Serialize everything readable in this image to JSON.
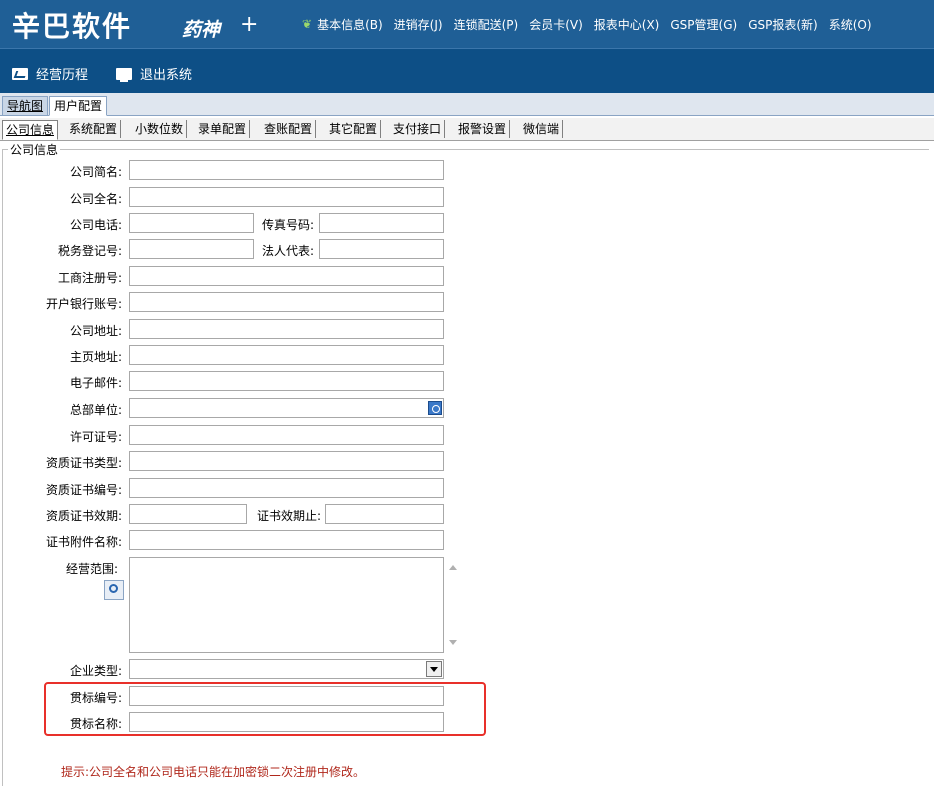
{
  "app": {
    "logo": "辛巴软件",
    "logo_sub": "药神",
    "logo_plus": "+"
  },
  "menu": [
    {
      "label": "基本信息(B)"
    },
    {
      "label": "进销存(J)"
    },
    {
      "label": "连锁配送(P)"
    },
    {
      "label": "会员卡(V)"
    },
    {
      "label": "报表中心(X)"
    },
    {
      "label": "GSP管理(G)"
    },
    {
      "label": "GSP报表(新)"
    },
    {
      "label": "系统(O)"
    }
  ],
  "toolbar": {
    "history_label": "经营历程",
    "exit_label": "退出系统"
  },
  "top_tabs": [
    {
      "label": "导航图"
    },
    {
      "label": "用户配置"
    }
  ],
  "config_tabs": [
    {
      "label": "公司信息"
    },
    {
      "label": "系统配置"
    },
    {
      "label": "小数位数"
    },
    {
      "label": "录单配置"
    },
    {
      "label": "查账配置"
    },
    {
      "label": "其它配置"
    },
    {
      "label": "支付接口"
    },
    {
      "label": "报警设置"
    },
    {
      "label": "微信端"
    }
  ],
  "group": {
    "title": "公司信息"
  },
  "form": {
    "short_name": "公司简名:",
    "full_name": "公司全名:",
    "phone": "公司电话:",
    "fax": "传真号码:",
    "tax_no": "税务登记号:",
    "legal_rep": "法人代表:",
    "biz_reg_no": "工商注册号:",
    "bank_account": "开户银行账号:",
    "address": "公司地址:",
    "homepage": "主页地址:",
    "email": "电子邮件:",
    "hq_unit": "总部单位:",
    "license_no": "许可证号:",
    "cert_type": "资质证书类型:",
    "cert_no": "资质证书编号:",
    "cert_valid": "资质证书效期:",
    "cert_expire": "证书效期止:",
    "cert_attachment": "证书附件名称:",
    "business_scope": "经营范围:",
    "enterprise_type": "企业类型:",
    "standard_no": "贯标编号:",
    "standard_name": "贯标名称:"
  },
  "hint": "提示:公司全名和公司电话只能在加密锁二次注册中修改。",
  "colors": {
    "header_bg": "#1f5f96",
    "toolbar_bg": "#0d4f86",
    "highlight": "#e8302a",
    "hint_text": "#b0281c"
  }
}
